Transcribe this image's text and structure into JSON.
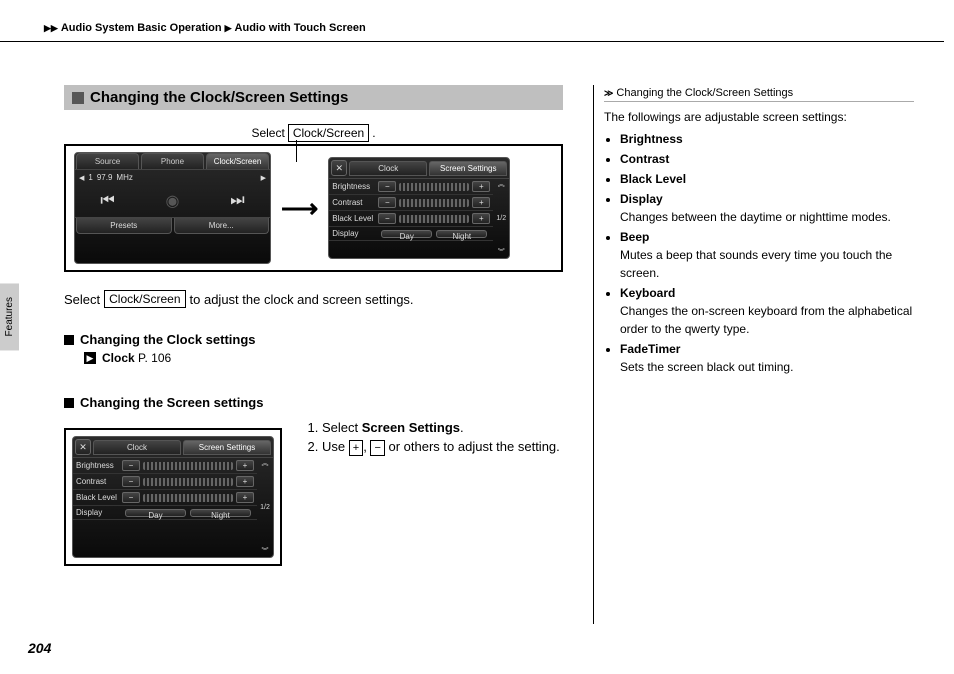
{
  "breadcrumb": {
    "level1": "Audio System Basic Operation",
    "level2": "Audio with Touch Screen"
  },
  "section_title": "Changing the Clock/Screen Settings",
  "callout_prefix": "Select",
  "callout_button": "Clock/Screen",
  "callout_suffix": ".",
  "intro_prefix": "Select",
  "intro_button": "Clock/Screen",
  "intro_suffix": "to adjust the clock and screen settings.",
  "sub1": "Changing the Clock settings",
  "xref_label": "Clock",
  "xref_page": "P. 106",
  "sub2": "Changing the Screen settings",
  "steps": {
    "s1_prefix": "Select",
    "s1_bold": "Screen Settings",
    "s1_suffix": ".",
    "s2_prefix": "Use",
    "s2_plus": "+",
    "s2_mid": ",",
    "s2_minus": "−",
    "s2_suffix": "or others to adjust the setting."
  },
  "screen1": {
    "tabs": [
      "Source",
      "Phone",
      "Clock/Screen"
    ],
    "freq_value": "97.9",
    "freq_unit": "MHz",
    "band": "1",
    "bottom": [
      "Presets",
      "More..."
    ]
  },
  "screen2": {
    "tabs": [
      "Clock",
      "Screen Settings"
    ],
    "rows": [
      {
        "label": "Brightness",
        "type": "slider"
      },
      {
        "label": "Contrast",
        "type": "slider"
      },
      {
        "label": "Black Level",
        "type": "slider"
      },
      {
        "label": "Display",
        "type": "day",
        "opts": [
          "Day",
          "Night"
        ]
      }
    ],
    "page_ind": "1/2"
  },
  "screen3": {
    "tabs": [
      "Clock",
      "Screen Settings"
    ],
    "rows": [
      {
        "label": "Brightness",
        "type": "slider"
      },
      {
        "label": "Contrast",
        "type": "slider"
      },
      {
        "label": "Black Level",
        "type": "slider"
      },
      {
        "label": "Display",
        "type": "day",
        "opts": [
          "Day",
          "Night"
        ]
      }
    ],
    "page_ind": "1/2"
  },
  "side_tab": "Features",
  "right": {
    "title": "Changing the Clock/Screen Settings",
    "intro": "The followings are adjustable screen settings:",
    "items": [
      {
        "title": "Brightness"
      },
      {
        "title": "Contrast"
      },
      {
        "title": "Black Level"
      },
      {
        "title": "Display",
        "desc": "Changes between the daytime or nighttime modes."
      },
      {
        "title": "Beep",
        "desc": "Mutes a beep that sounds every time you touch the screen."
      },
      {
        "title": "Keyboard",
        "desc": "Changes the on-screen keyboard from the alphabetical order to the qwerty type."
      },
      {
        "title": "FadeTimer",
        "desc": "Sets the screen black out timing."
      }
    ]
  },
  "page_number": "204"
}
